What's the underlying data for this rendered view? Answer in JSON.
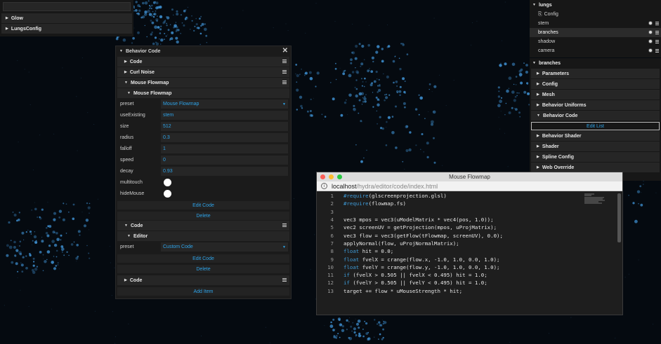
{
  "left_panel": {
    "glow": "Glow",
    "lungs_config": "LungsConfig"
  },
  "behavior_panel": {
    "title": "Behavior Code",
    "code1": "Code",
    "curl": "Curl Noise",
    "mouse_flowmap": "Mouse Flowmap",
    "mouse_flowmap_inner": "Mouse Flowmap",
    "props": [
      {
        "label": "preset",
        "value": "Mouse Flowmap"
      },
      {
        "label": "useExisting",
        "value": "stem"
      },
      {
        "label": "size",
        "value": "512"
      },
      {
        "label": "radius",
        "value": "0.3"
      },
      {
        "label": "falloff",
        "value": "1"
      },
      {
        "label": "speed",
        "value": "0"
      },
      {
        "label": "decay",
        "value": "0.93"
      }
    ],
    "multitouch": "multitouch",
    "hidemouse": "hideMouse",
    "edit_code": "Edit Code",
    "delete": "Delete",
    "code2": "Code",
    "editor": "Editor",
    "preset_label": "preset",
    "preset_value": "Custom Code",
    "edit_code2": "Edit Code",
    "delete2": "Delete",
    "code3": "Code",
    "add_item": "Add Item"
  },
  "scene_tree": {
    "root": "lungs",
    "config": "Config",
    "items": [
      "stem",
      "branches",
      "shadow",
      "camera"
    ]
  },
  "branches_panel": {
    "title": "branches",
    "sections": [
      "Parameters",
      "Config",
      "Mesh",
      "Behavior Uniforms",
      "Behavior Code"
    ],
    "edit_list": "Edit List",
    "sections2": [
      "Behavior Shader",
      "Shader",
      "Spline Config",
      "Web Override"
    ]
  },
  "browser": {
    "title": "Mouse Flowmap",
    "url_host": "localhost",
    "url_path": "/hydra/editor/code/index.html",
    "lines": [
      {
        "n": "1",
        "pre": "",
        "kw": "#require",
        "post": "(glscreenprojection.glsl)"
      },
      {
        "n": "2",
        "pre": "",
        "kw": "#require",
        "post": "(flowmap.fs)"
      },
      {
        "n": "3",
        "pre": "",
        "kw": "",
        "post": ""
      },
      {
        "n": "4",
        "pre": "",
        "kw": "",
        "post": "vec3 mpos = vec3(uModelMatrix * vec4(pos, 1.0));"
      },
      {
        "n": "5",
        "pre": "",
        "kw": "",
        "post": "vec2 screenUV = getProjection(mpos, uProjMatrix);"
      },
      {
        "n": "6",
        "pre": "",
        "kw": "",
        "post": "vec3 flow = vec3(getFlow(tFlowmap, screenUV), 0.0);"
      },
      {
        "n": "7",
        "pre": "",
        "kw": "",
        "post": "applyNormal(flow, uProjNormalMatrix);"
      },
      {
        "n": "8",
        "pre": "",
        "kw": "float",
        "post": " hit = 0.0;"
      },
      {
        "n": "9",
        "pre": "",
        "kw": "float",
        "post": " fvelX = crange(flow.x, -1.0, 1.0, 0.0, 1.0);"
      },
      {
        "n": "10",
        "pre": "",
        "kw": "float",
        "post": " fvelY = crange(flow.y, -1.0, 1.0, 0.0, 1.0);"
      },
      {
        "n": "11",
        "pre": "",
        "kw": "if",
        "post": " (fvelX > 0.505 || fvelX < 0.495) hit = 1.0;"
      },
      {
        "n": "12",
        "pre": "",
        "kw": "if",
        "post": " (fvelY > 0.505 || fvelY < 0.495) hit = 1.0;"
      },
      {
        "n": "13",
        "pre": "",
        "kw": "",
        "post": "target += flow * uMouseStrength * hit;"
      }
    ]
  },
  "colors": {
    "accent": "#2ea3e8",
    "panel": "#1b1b1b",
    "row": "#262626"
  }
}
